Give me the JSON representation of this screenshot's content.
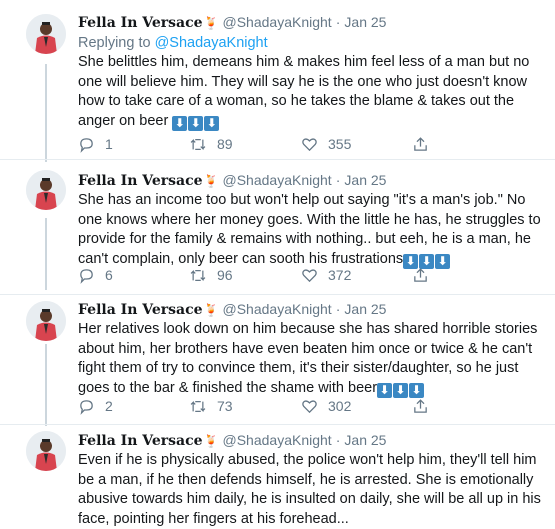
{
  "colors": {
    "link": "#1da1f2",
    "muted": "#657786",
    "divider": "#e6ecf0",
    "arrow_badge": "#3b88c3"
  },
  "tweets": [
    {
      "name": "Fella In Versace",
      "emoji": "🍹",
      "handle": "@ShadayaKnight",
      "sep": "·",
      "date": "Jan 25",
      "reply_prefix": "Replying to",
      "reply_to": "@ShadayaKnight",
      "text": "She belittles him, demeans him & makes him feel less of a man but no one will believe him. They will say he is the one who just doesn't know how to take care of a woman, so he takes the blame & takes out the anger on beer",
      "arrow": "⬇",
      "replies": "1",
      "retweets": "89",
      "likes": "355"
    },
    {
      "name": "Fella In Versace",
      "emoji": "🍹",
      "handle": "@ShadayaKnight",
      "sep": "·",
      "date": "Jan 25",
      "text": "She has an income too but won't help out saying \"it's a man's job.\" No one knows where her money goes. With the little he has, he struggles to provide for the family & remains with nothing.. but eeh, he is a man, he can't complain, only beer can sooth his frustrations",
      "arrow": "⬇",
      "replies": "6",
      "retweets": "96",
      "likes": "372"
    },
    {
      "name": "Fella In Versace",
      "emoji": "🍹",
      "handle": "@ShadayaKnight",
      "sep": "·",
      "date": "Jan 25",
      "text": "Her relatives look down on him because she has shared horrible stories about him, her brothers have even beaten him once or twice & he can't fight them of try to convince them, it's their sister/daughter, so he just goes to the bar & finished the shame with beer",
      "arrow": "⬇",
      "replies": "2",
      "retweets": "73",
      "likes": "302"
    },
    {
      "name": "Fella In Versace",
      "emoji": "🍹",
      "handle": "@ShadayaKnight",
      "sep": "·",
      "date": "Jan 25",
      "text": "Even if he is physically abused, the police won't help him, they'll tell him be a man, if he then defends himself, he is arrested. She is emotionally abusive towards him daily, he is insulted on daily, she will be all up in his face, pointing her fingers at his forehead..."
    }
  ]
}
